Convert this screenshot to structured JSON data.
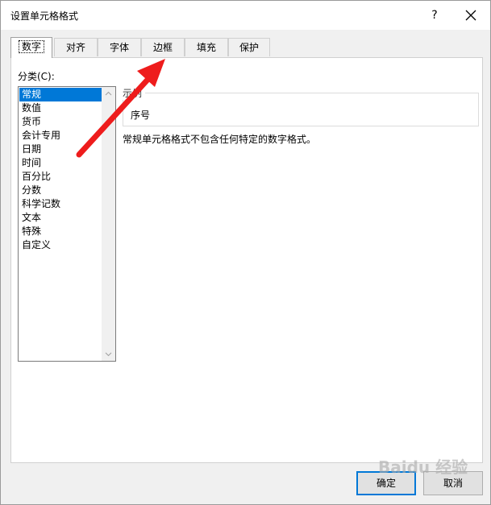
{
  "window": {
    "title": "设置单元格格式",
    "help_label": "?"
  },
  "tabs": [
    {
      "label": "数字",
      "active": true
    },
    {
      "label": "对齐",
      "active": false
    },
    {
      "label": "字体",
      "active": false
    },
    {
      "label": "边框",
      "active": false
    },
    {
      "label": "填充",
      "active": false
    },
    {
      "label": "保护",
      "active": false
    }
  ],
  "category": {
    "label": "分类(C):",
    "items": [
      "常规",
      "数值",
      "货币",
      "会计专用",
      "日期",
      "时间",
      "百分比",
      "分数",
      "科学记数",
      "文本",
      "特殊",
      "自定义"
    ],
    "selected": "常规"
  },
  "sample": {
    "legend": "示例",
    "value": "序号"
  },
  "description": "常规单元格格式不包含任何特定的数字格式。",
  "buttons": {
    "ok": "确定",
    "cancel": "取消"
  },
  "watermark": "Baidu 经验",
  "colors": {
    "accent": "#0078d7",
    "annotation_arrow": "#ee1c1c"
  }
}
